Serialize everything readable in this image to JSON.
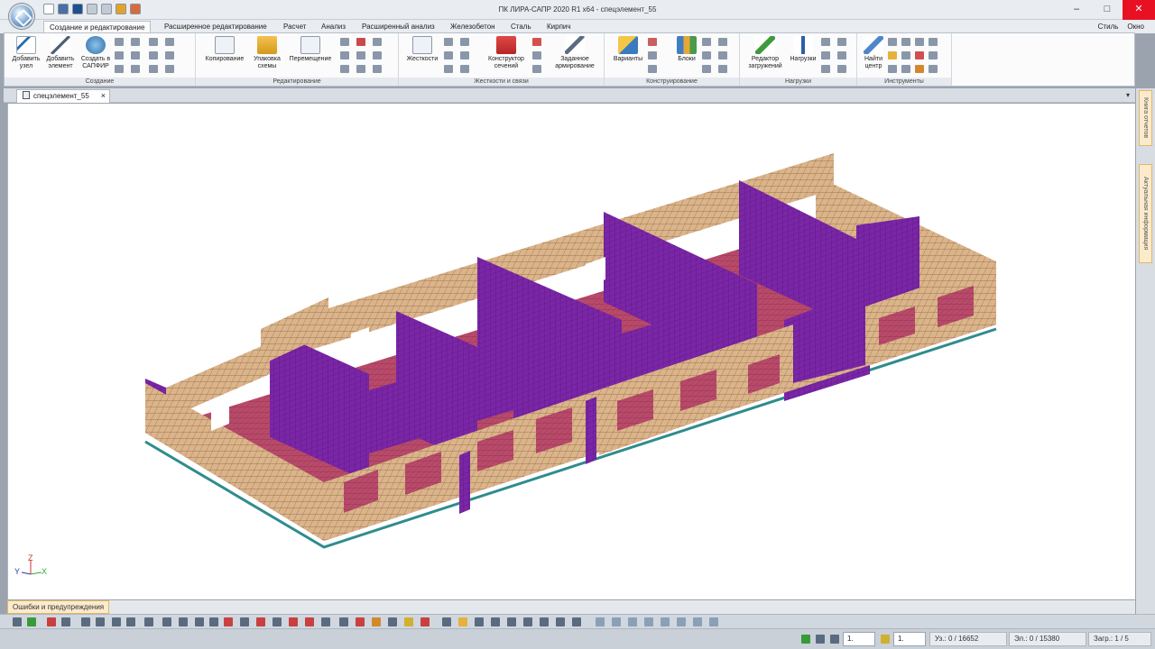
{
  "window": {
    "title": "ПК ЛИРА-САПР 2020 R1 x64 - спецэлемент_55",
    "controls": [
      "–",
      "□",
      "✕"
    ]
  },
  "ribbon_tabs": [
    "Создание и редактирование",
    "Расширенное редактирование",
    "Расчет",
    "Анализ",
    "Расширенный анализ",
    "Железобетон",
    "Сталь",
    "Кирпич"
  ],
  "menu_right": {
    "style": "Стиль",
    "window": "Окно"
  },
  "groups": {
    "create": {
      "label": "Создание",
      "buttons": [
        "Добавить узел",
        "Добавить элемент",
        "Создать в САПФИР"
      ]
    },
    "edit": {
      "label": "Редактирование",
      "buttons": [
        "Копирование",
        "Упаковка схемы",
        "Перемещение"
      ]
    },
    "stiff": {
      "label": "Жесткости и связи",
      "buttons": [
        "Жесткости",
        "Конструктор сечений",
        "Заданное армирование"
      ]
    },
    "design": {
      "label": "Конструирование",
      "buttons": [
        "Варианты",
        "Блоки"
      ]
    },
    "loads": {
      "label": "Нагрузки",
      "buttons": [
        "Редактор загружений",
        "Нагрузки"
      ]
    },
    "tools": {
      "label": "Инструменты",
      "buttons": [
        "Найти центр"
      ]
    }
  },
  "document_tab": "спецэлемент_55",
  "side_panels": [
    "Книга отчетов",
    "Актуальная информация"
  ],
  "axes": {
    "z": "Z",
    "y": "Y",
    "x": "X"
  },
  "errors_tab": "Ошибки и предупреждения",
  "status": {
    "field1": "1.",
    "field2": "1.",
    "nodes": "Уз.: 0 / 16652",
    "elements": "Эл.: 0 / 15380",
    "load": "Загр.: 1 / 5"
  },
  "colors": {
    "wall_outer": "#dcb48a",
    "wall_inner": "#7a26a6",
    "floor": "#b94a6a",
    "slab_edge": "#2f8c8c",
    "ribbon_bg": "#fbfbfc"
  }
}
